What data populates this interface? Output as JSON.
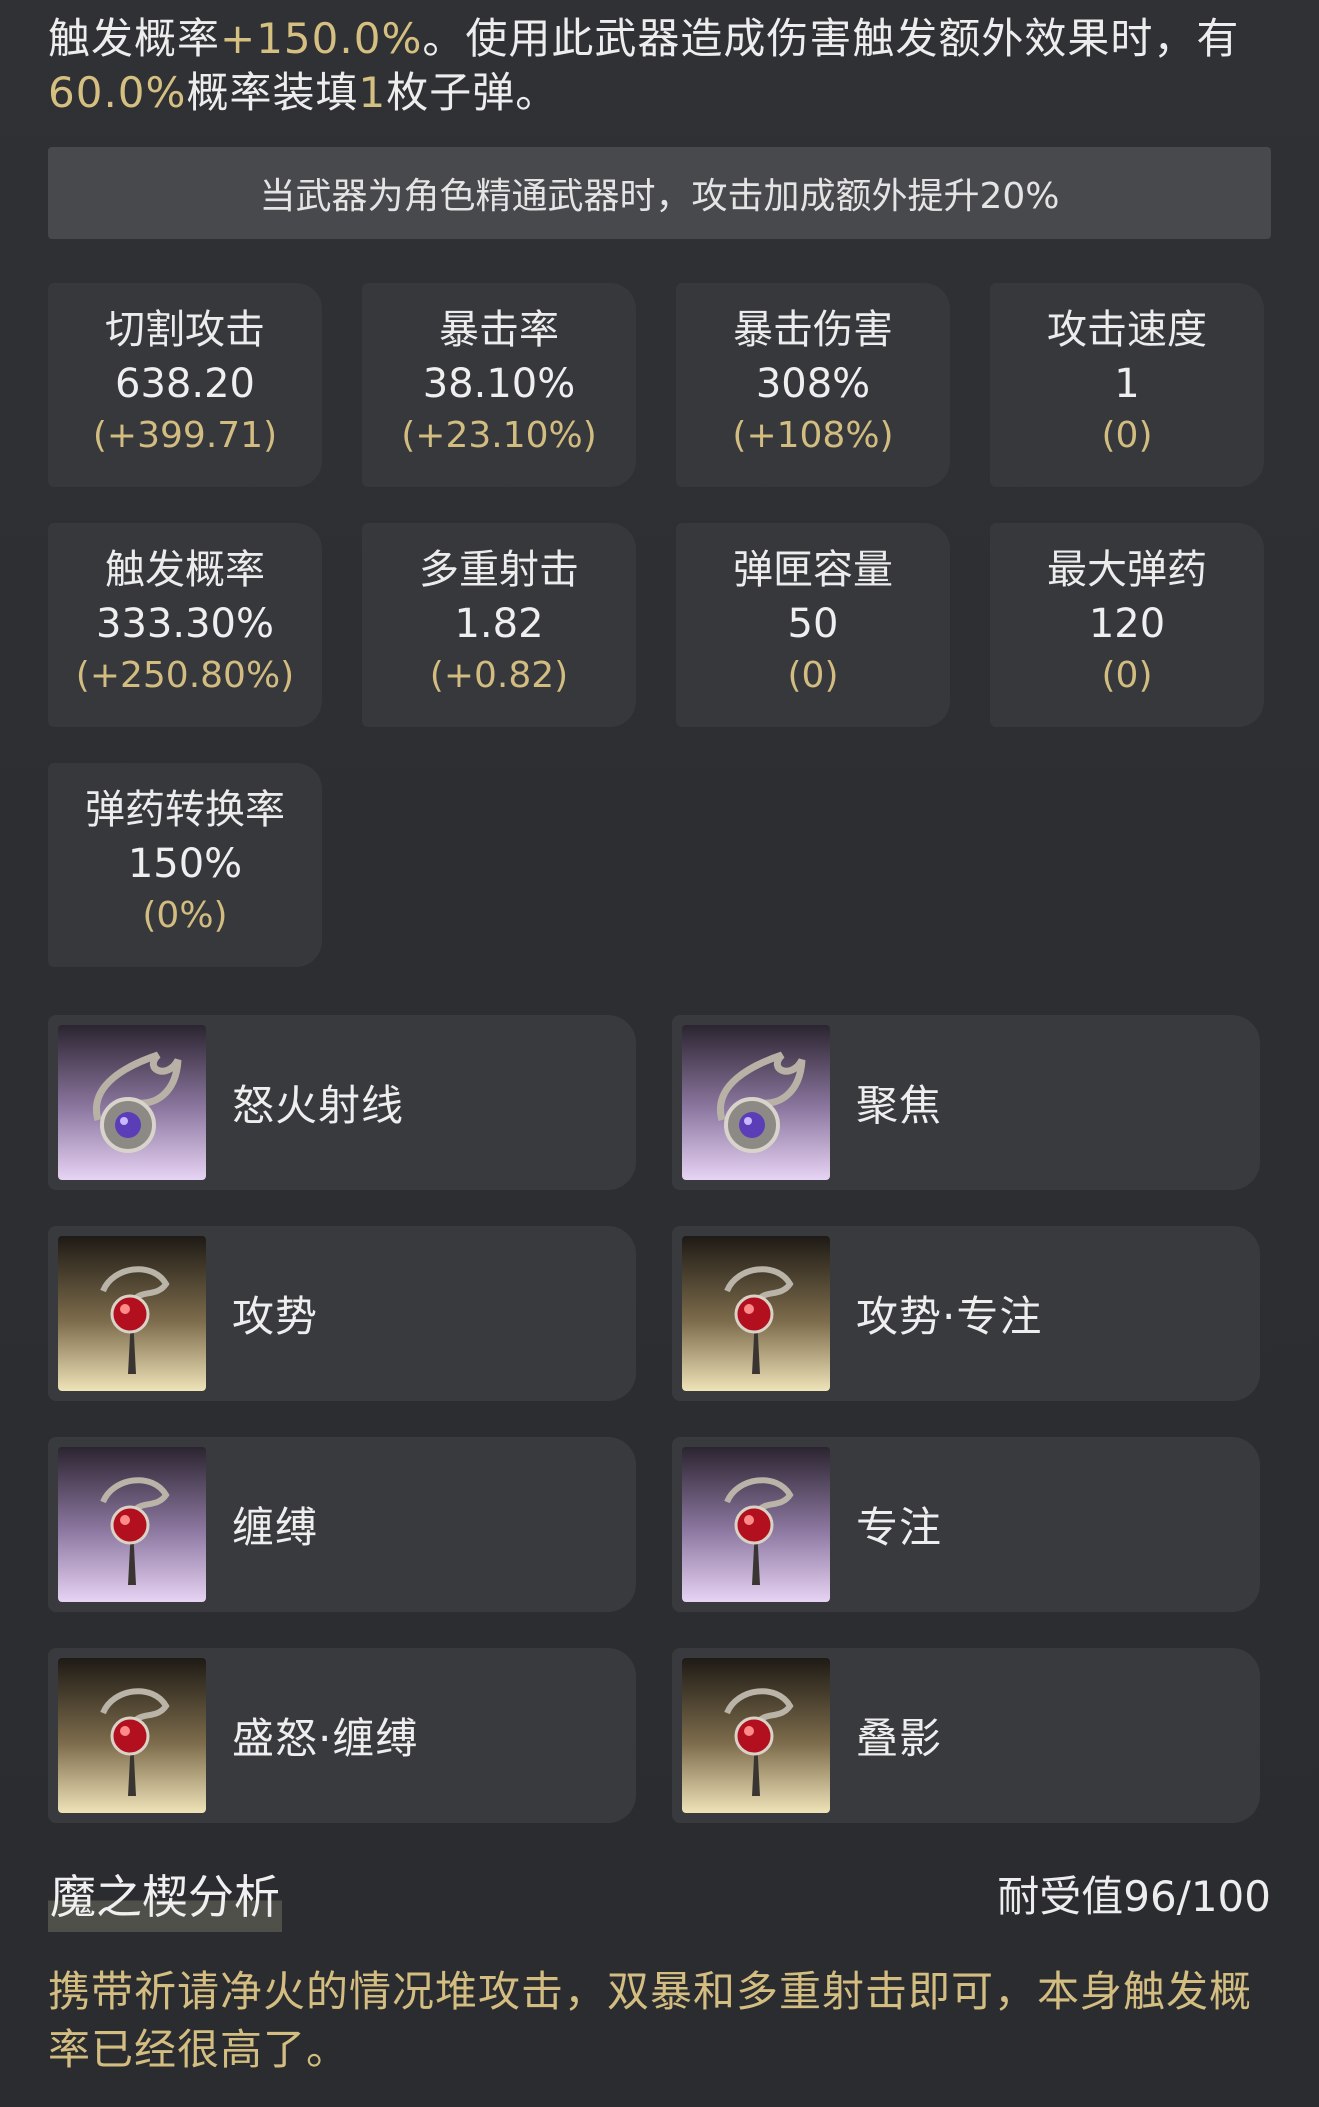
{
  "description": {
    "part1": "触发概率",
    "hl1": "+150.0%",
    "part2": "。使用此武器造成伤害触发额外效果时，有",
    "hl2": "60.0%",
    "part3": "概率装填",
    "hl3": "1",
    "part4": "枚子弹。"
  },
  "banner": "当武器为角色精通武器时，攻击加成额外提升20%",
  "stats": [
    {
      "name": "切割攻击",
      "value": "638.20",
      "delta": "(+399.71)"
    },
    {
      "name": "暴击率",
      "value": "38.10%",
      "delta": "(+23.10%)"
    },
    {
      "name": "暴击伤害",
      "value": "308%",
      "delta": "(+108%)"
    },
    {
      "name": "攻击速度",
      "value": "1",
      "delta": "(0)"
    },
    {
      "name": "触发概率",
      "value": "333.30%",
      "delta": "(+250.80%)"
    },
    {
      "name": "多重射击",
      "value": "1.82",
      "delta": "(+0.82)"
    },
    {
      "name": "弹匣容量",
      "value": "50",
      "delta": "(0)"
    },
    {
      "name": "最大弹药",
      "value": "120",
      "delta": "(0)"
    },
    {
      "name": "弹药转换率",
      "value": "150%",
      "delta": "(0%)"
    }
  ],
  "mods": [
    {
      "name": "怒火射线",
      "icon": "purple-orb-mod-icon",
      "rarity_color": "#8f7aa3"
    },
    {
      "name": "聚焦",
      "icon": "purple-orb-mod-icon",
      "rarity_color": "#8f7aa3"
    },
    {
      "name": "攻势",
      "icon": "red-gem-mod-icon",
      "rarity_color": "#d8c894"
    },
    {
      "name": "攻势·专注",
      "icon": "red-gem-mod-icon",
      "rarity_color": "#d8c894"
    },
    {
      "name": "缠缚",
      "icon": "red-gem-mod-icon",
      "rarity_color": "#8f7aa3"
    },
    {
      "name": "专注",
      "icon": "red-gem-mod-icon",
      "rarity_color": "#8f7aa3"
    },
    {
      "name": "盛怒·缠缚",
      "icon": "red-gem-mod-icon",
      "rarity_color": "#d8c894"
    },
    {
      "name": "叠影",
      "icon": "red-gem-mod-icon",
      "rarity_color": "#d8c894"
    }
  ],
  "analysis": {
    "title": "魔之楔分析",
    "endurance": "耐受值96/100",
    "comment": "携带祈请净火的情况堆攻击，双暴和多重射击即可，本身触发概率已经很高了。"
  },
  "colors": {
    "highlight": "#d6c081",
    "background": "#2e3034",
    "card": "#36383c"
  }
}
